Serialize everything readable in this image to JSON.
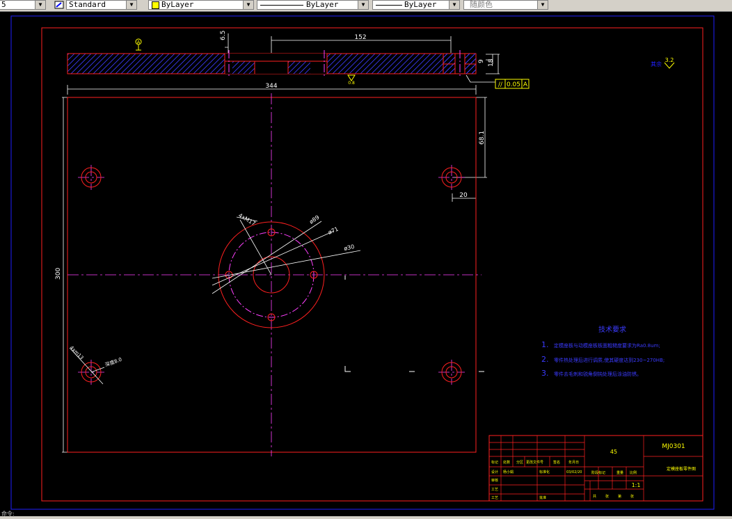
{
  "toolbar": {
    "layer_value": "5",
    "text_style": "Standard",
    "color_value": "ByLayer",
    "linetype_value": "ByLayer",
    "lineweight_value": "ByLayer",
    "plotstyle_value": "随颜色"
  },
  "drawing": {
    "dims": {
      "d6_5": "6.5",
      "d152": "152",
      "d9": "9",
      "d18": "18",
      "d344": "344",
      "d68_1": "68.1",
      "d20": "20",
      "d300": "300",
      "m4xm17": "4xM17",
      "phi89": "ø89",
      "phi71": "ø71",
      "phi30": "ø30",
      "m4xm13": "4xm13",
      "depth": "深度8.0"
    },
    "datum_label": "A",
    "tolerance": {
      "symbol": "//",
      "value": "0.05",
      "datum": "A"
    },
    "roughness_note": "其余",
    "roughness_value": "3.2",
    "roughness_small": "0.8",
    "tech_title": "技术要求",
    "tech_reqs": [
      {
        "num": "1.",
        "text": "定模座板与动模座板板面粗糙度要求为Ra0.8um;"
      },
      {
        "num": "2.",
        "text": "零件热处理后进行调质,使其硬度达到230~270HB;"
      },
      {
        "num": "3.",
        "text": "零件去毛刺和锐角倒钝处理后涂油防锈。"
      }
    ],
    "title_block": {
      "material": "45",
      "drawing_no": "MJ0301",
      "part_name": "定模座板零件图",
      "scale": "1:1",
      "hdr": [
        "标记",
        "处数",
        "分区",
        "更改文件号",
        "签名",
        "年月日"
      ],
      "designer_label": "设计",
      "designer": "杨小娟",
      "std_label": "标准化",
      "date": "03/02/20",
      "stage_label": "阶段标记",
      "weight_label": "重量",
      "scale_label": "比例",
      "review_label": "审核",
      "process_label": "工艺",
      "approve_label": "批准",
      "sheet_labels": [
        "共",
        "张",
        "第",
        "张"
      ]
    }
  },
  "command_line": "命令:"
}
